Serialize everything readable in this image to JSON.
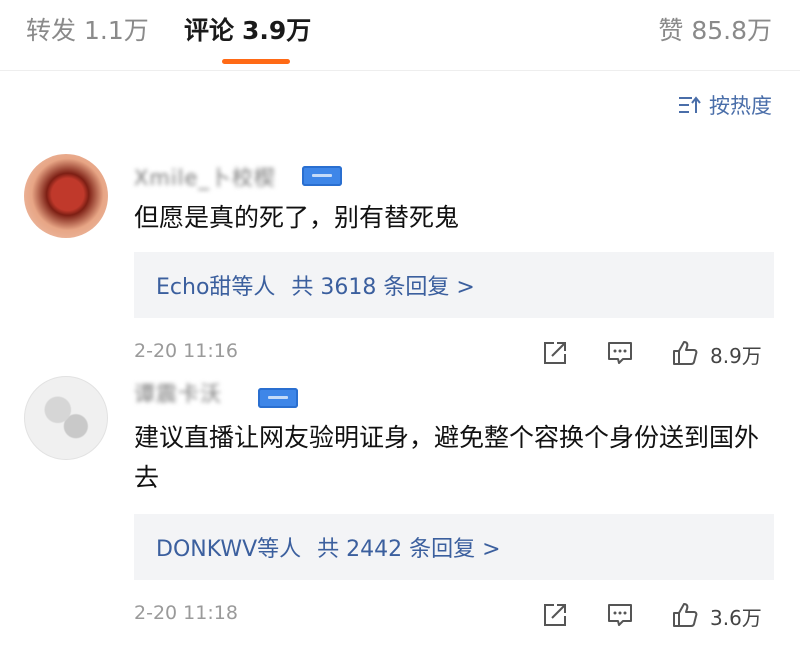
{
  "tabs": {
    "repost": {
      "label": "转发",
      "count": "1.1万"
    },
    "comments": {
      "label": "评论",
      "count": "3.9万"
    },
    "likes": {
      "label": "赞",
      "count": "85.8万"
    }
  },
  "sort": {
    "label": "按热度",
    "icon": "sort-lines-icon"
  },
  "accent_color": "#ff6a16",
  "link_color": "#3b5f9e",
  "comments": [
    {
      "username": "Xmile_卜校楔",
      "text": "但愿是真的死了，别有替死鬼",
      "replies_who": "Echo甜等人",
      "replies_total": "共 3618 条回复 >",
      "timestamp": "2-20 11:16",
      "likes": "8.9万"
    },
    {
      "username": "谭震卡沃",
      "text": "建议直播让网友验明证身，避免整个容换个身份送到国外去",
      "replies_who": "DONKWV等人",
      "replies_total": "共 2442 条回复 >",
      "timestamp": "2-20 11:18",
      "likes": "3.6万"
    }
  ]
}
